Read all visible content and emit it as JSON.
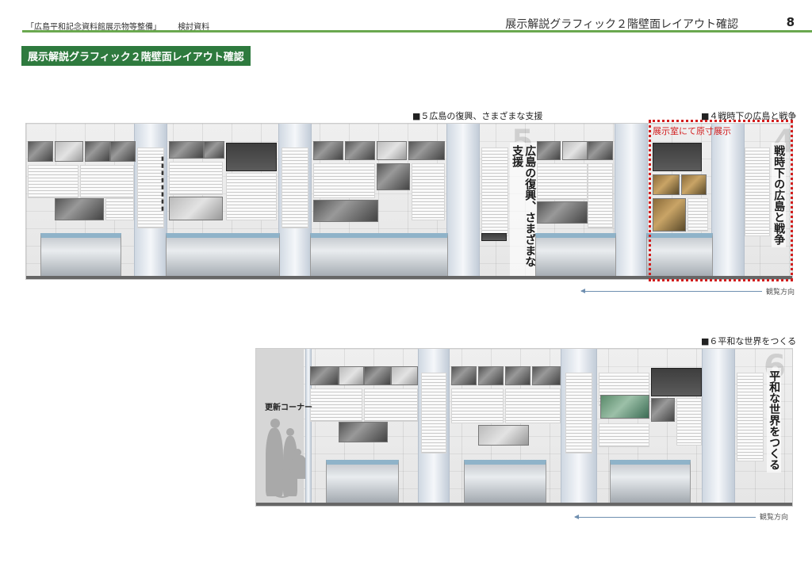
{
  "header": {
    "doc_title": "「広島平和記念資料館展示物等整備」",
    "doc_type": "検討資料",
    "section_title": "展示解説グラフィック２階壁面レイアウト確認",
    "page_number": "8"
  },
  "section_tag": "展示解説グラフィック２階壁面レイアウト確認",
  "wall1": {
    "label_5": "■５広島の復興、さまざまな支援",
    "label_4": "■４戦時下の広島と戦争",
    "red_note": "展示室にて原寸展示",
    "title_5": "広島の復興、さまざまな支援",
    "title_4": "戦時下の広島と戦争",
    "number_5": "5",
    "number_4": "4",
    "direction": "観覧方向"
  },
  "wall2": {
    "label_6": "■６平和な世界をつくる",
    "update_corner": "更新コーナー",
    "title_6": "平和な世界をつくる",
    "number_6": "6",
    "direction": "観覧方向"
  },
  "colors": {
    "accent_green": "#2e7a3e",
    "rule_green": "#6aa84f",
    "highlight_red": "#d21d1d"
  }
}
